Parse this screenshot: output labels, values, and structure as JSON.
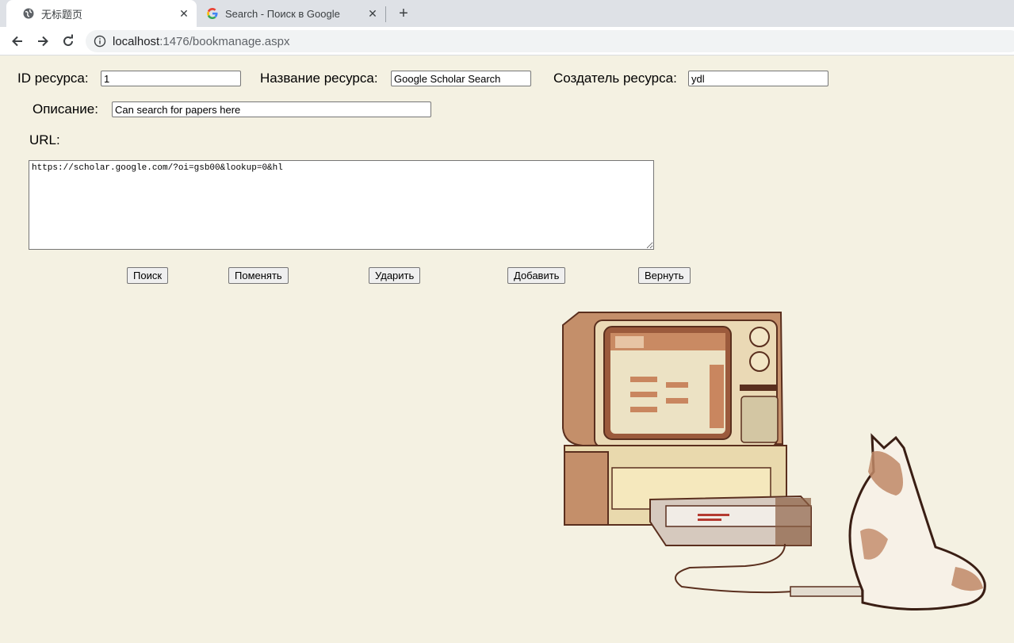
{
  "browser": {
    "tabs": [
      {
        "title": "无标题页",
        "active": true,
        "favicon": "globe-icon"
      },
      {
        "title": "Search - Поиск в Google",
        "active": false,
        "favicon": "google-icon"
      }
    ],
    "url_host": "localhost",
    "url_path": ":1476/bookmanage.aspx"
  },
  "form": {
    "id_label": "ID ресурса:",
    "id_value": "1",
    "name_label": "Название ресурса:",
    "name_value": "Google Scholar Search",
    "creator_label": "Создатель ресурса:",
    "creator_value": "ydl",
    "desc_label": "Описание:",
    "desc_value": "Can search for papers here",
    "url_label": "URL:",
    "url_value": "https://scholar.google.com/?oi=gsb00&lookup=0&hl"
  },
  "buttons": {
    "search": "Поиск",
    "change": "Поменять",
    "delete": "Ударить",
    "add": "Добавить",
    "back": "Вернуть"
  },
  "colors": {
    "page_bg": "#f4f1e2",
    "tabstrip_bg": "#dee1e6"
  }
}
